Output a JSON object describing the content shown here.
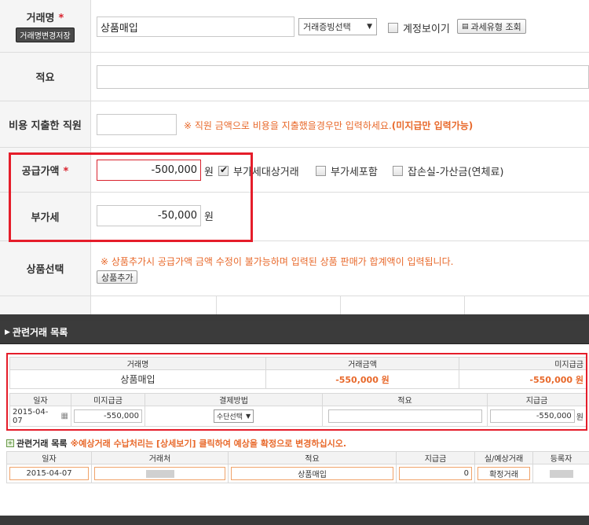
{
  "form": {
    "trade_name": {
      "label": "거래명",
      "required": "*",
      "save_button": "거래명변경저장",
      "value": "상품매입",
      "evidence_select": "거래증빙선택",
      "show_account_label": "계정보이기",
      "tax_type_button": "과세유형 조회"
    },
    "memo": {
      "label": "적요",
      "value": ""
    },
    "employee": {
      "label": "비용 지출한 직원",
      "value": "",
      "note": "※ 직원 금액으로 비용을 지출했을경우만 입력하세요.",
      "note_bold": "(미지급만 입력가능)"
    },
    "supply": {
      "label": "공급가액",
      "required": "*",
      "value": "-500,000",
      "unit": "원",
      "vat_target_label": "부가세대상거래",
      "vat_target_checked": true,
      "vat_included_label": "부가세포함",
      "vat_included_checked": false,
      "misc_loss_label": "잡손실-가산금(연체료)",
      "misc_loss_checked": false
    },
    "vat": {
      "label": "부가세",
      "value": "-50,000",
      "unit": "원"
    },
    "product": {
      "label": "상품선택",
      "note": "※ 상품추가시 공급가액 금액 수정이 불가능하며 입력된 상품 판매가 합계액이 입력됩니다.",
      "add_button": "상품추가"
    }
  },
  "modal": {
    "title": "관련거래 목록",
    "summary": {
      "headers": [
        "거래명",
        "거래금액",
        "미지급금"
      ],
      "values": [
        "상품매입",
        "-550,000 원",
        "-550,000 원"
      ]
    },
    "payment": {
      "headers": [
        "일자",
        "미지급금",
        "결제방법",
        "적요",
        "지급금"
      ],
      "date": "2015-04-07",
      "unpaid": "-550,000",
      "method": "수단선택",
      "memo": "",
      "paid": "-550,000",
      "unit": "원"
    },
    "related": {
      "title": "관련거래 목록",
      "note": "※예상거래 수납처리는 [상세보기] 클릭하여 예상을 확정으로 변경하십시오.",
      "headers": [
        "일자",
        "거래처",
        "적요",
        "지급금",
        "실/예상거래",
        "등록자"
      ],
      "rows": [
        {
          "date": "2015-04-07",
          "memo": "상품매입",
          "amount": "0",
          "type": "확정거래"
        }
      ]
    }
  }
}
